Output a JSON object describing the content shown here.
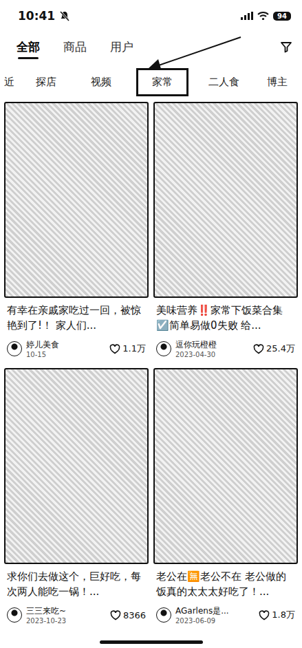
{
  "status_bar": {
    "time": "10:41",
    "battery": "94"
  },
  "tabs": [
    {
      "label": "全部",
      "selected": true
    },
    {
      "label": "商品",
      "selected": false
    },
    {
      "label": "用户",
      "selected": false
    }
  ],
  "chips": [
    {
      "label": "近",
      "selected": false
    },
    {
      "label": "探店",
      "selected": false
    },
    {
      "label": "视频",
      "selected": false
    },
    {
      "label": "家常",
      "selected": true
    },
    {
      "label": "二人食",
      "selected": false
    },
    {
      "label": "博主",
      "selected": false
    }
  ],
  "cards": [
    {
      "title": "有幸在亲戚家吃过一回，被惊艳到了!！ 家人们...",
      "author": "婷儿美食",
      "date": "10-15",
      "likes": "1.1万"
    },
    {
      "title": "美味营养‼️家常下饭菜合集☑️简单易做0失败 给...",
      "author": "逗你玩橙橙",
      "date": "2023-04-30",
      "likes": "25.4万"
    },
    {
      "title": "求你们去做这个，巨好吃，每次两人能吃一锅！...",
      "author": "三三来吃~",
      "date": "2023-10-23",
      "likes": "8366"
    },
    {
      "title": "老公在🈚老公不在 老公做的饭真的太太太好吃了！...",
      "author": "AGarlens是...",
      "date": "2023-06-09",
      "likes": "1.8万"
    }
  ]
}
